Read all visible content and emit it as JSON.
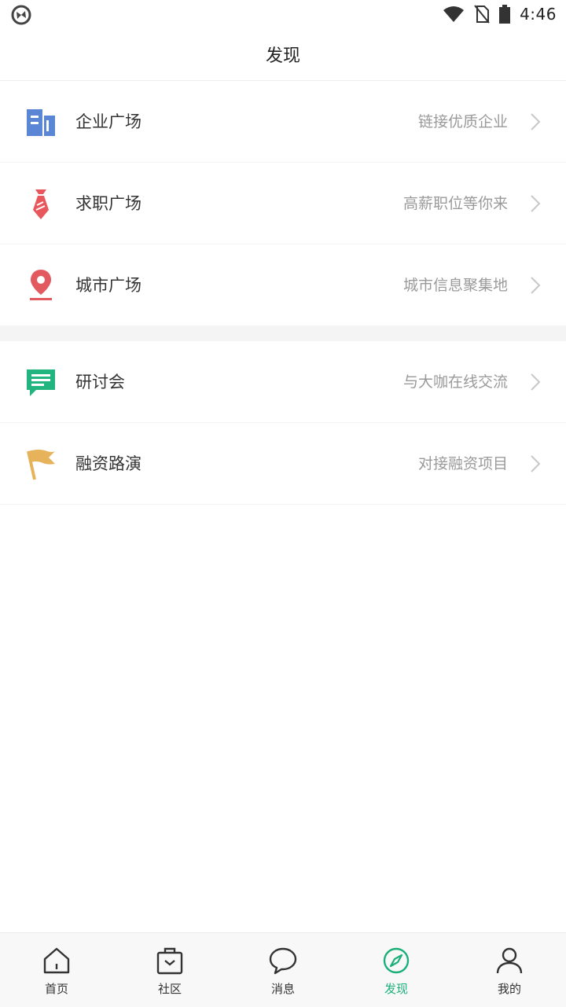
{
  "status_bar": {
    "time": "4:46",
    "icons": [
      "app-sync-icon",
      "wifi-icon",
      "no-sim-icon",
      "battery-icon"
    ]
  },
  "header": {
    "title": "发现"
  },
  "groups": [
    {
      "items": [
        {
          "icon": "building-icon",
          "title": "企业广场",
          "subtitle": "链接优质企业"
        },
        {
          "icon": "necktie-icon",
          "title": "求职广场",
          "subtitle": "高薪职位等你来"
        },
        {
          "icon": "location-pin-icon",
          "title": "城市广场",
          "subtitle": "城市信息聚集地"
        }
      ]
    },
    {
      "items": [
        {
          "icon": "chat-bubble-icon",
          "title": "研讨会",
          "subtitle": "与大咖在线交流"
        },
        {
          "icon": "flag-icon",
          "title": "融资路演",
          "subtitle": "对接融资项目"
        }
      ]
    }
  ],
  "tabbar": {
    "active": "发现",
    "tabs": [
      {
        "icon": "home-icon",
        "label": "首页"
      },
      {
        "icon": "briefcase-icon",
        "label": "社区"
      },
      {
        "icon": "message-icon",
        "label": "消息"
      },
      {
        "icon": "compass-icon",
        "label": "发现"
      },
      {
        "icon": "user-icon",
        "label": "我的"
      }
    ]
  },
  "colors": {
    "accent": "#1bb07a",
    "building": "#5b86d6",
    "tie": "#e8575b",
    "pin": "#e25a5f",
    "chat": "#22b57f",
    "flag": "#e7b35a"
  }
}
